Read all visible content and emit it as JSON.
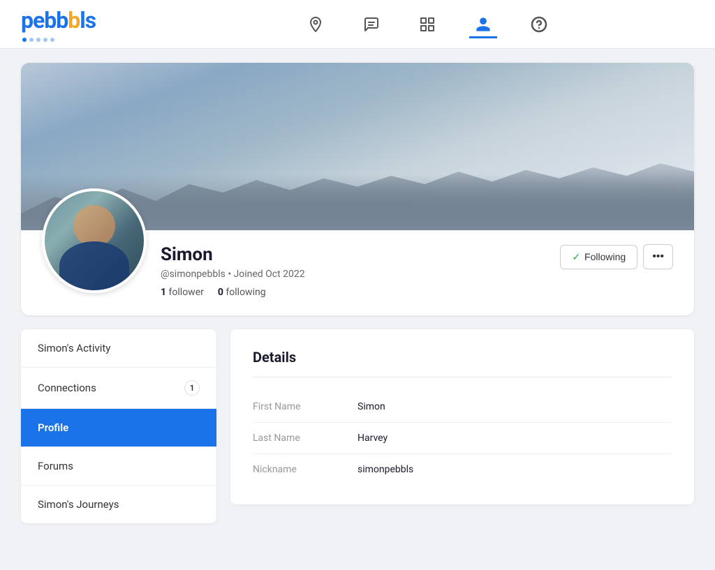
{
  "header": {
    "logo_text_start": "pebb",
    "logo_text_orange": "b",
    "logo_text_end": "ls",
    "nav_icons": [
      {
        "name": "location-pin-icon",
        "label": "Location",
        "active": false
      },
      {
        "name": "chat-icon",
        "label": "Chat",
        "active": false
      },
      {
        "name": "grid-icon",
        "label": "Grid",
        "active": false
      },
      {
        "name": "profile-icon",
        "label": "Profile",
        "active": true
      },
      {
        "name": "help-icon",
        "label": "Help",
        "active": false
      }
    ]
  },
  "profile": {
    "name": "Simon",
    "handle": "@simonpebbls",
    "joined": "Joined Oct 2022",
    "followers_count": "1",
    "followers_label": "follower",
    "following_count": "0",
    "following_label": "following",
    "following_button_label": "Following",
    "more_button_label": "•••"
  },
  "sidebar": {
    "items": [
      {
        "id": "simons-activity",
        "label": "Simon's Activity",
        "active": false,
        "badge": null
      },
      {
        "id": "connections",
        "label": "Connections",
        "active": false,
        "badge": "1"
      },
      {
        "id": "profile",
        "label": "Profile",
        "active": true,
        "badge": null
      },
      {
        "id": "forums",
        "label": "Forums",
        "active": false,
        "badge": null
      },
      {
        "id": "simons-journeys",
        "label": "Simon's Journeys",
        "active": false,
        "badge": null
      }
    ]
  },
  "details": {
    "title": "Details",
    "fields": [
      {
        "label": "First Name",
        "value": "Simon"
      },
      {
        "label": "Last Name",
        "value": "Harvey"
      },
      {
        "label": "Nickname",
        "value": "simonpebbls"
      }
    ]
  },
  "colors": {
    "brand_blue": "#1a73e8",
    "brand_orange": "#f5a623",
    "active_nav_border": "#1a73e8"
  }
}
